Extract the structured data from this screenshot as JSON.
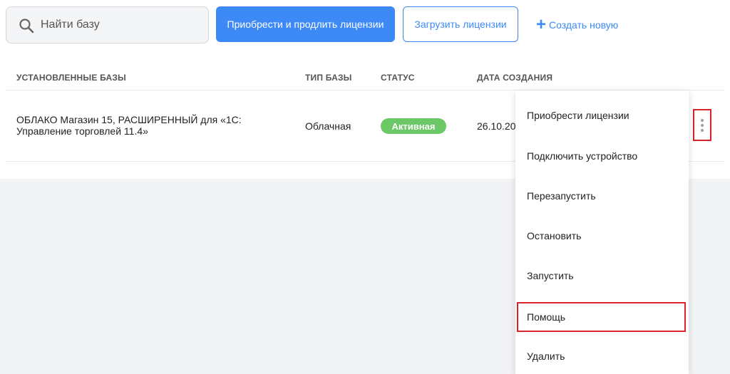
{
  "toolbar": {
    "search_placeholder": "Найти базу",
    "buy_button": "Приобрести и продлить лицензии",
    "upload_button": "Загрузить лицензии",
    "create_plus": "+",
    "create_link": "Создать новую"
  },
  "table": {
    "headers": [
      "Установленные базы",
      "Тип базы",
      "Статус",
      "Дата создания"
    ],
    "rows": [
      {
        "name": "ОБЛАКО Магазин 15, РАСШИРЕННЫЙ для «1С: Управление торговлей 11.4»",
        "type": "Облачная",
        "status": "Активная",
        "date": "26.10.20"
      }
    ]
  },
  "menu": {
    "items": [
      "Приобрести лицензии",
      "Подключить устройство",
      "Перезапустить",
      "Остановить",
      "Запустить",
      "Помощь",
      "Удалить"
    ]
  },
  "colors": {
    "accent": "#3d8af7",
    "status_active": "#6cc766",
    "highlight": "#d8232a"
  },
  "icons": {
    "search": "search-icon",
    "more": "more-vertical-icon"
  }
}
